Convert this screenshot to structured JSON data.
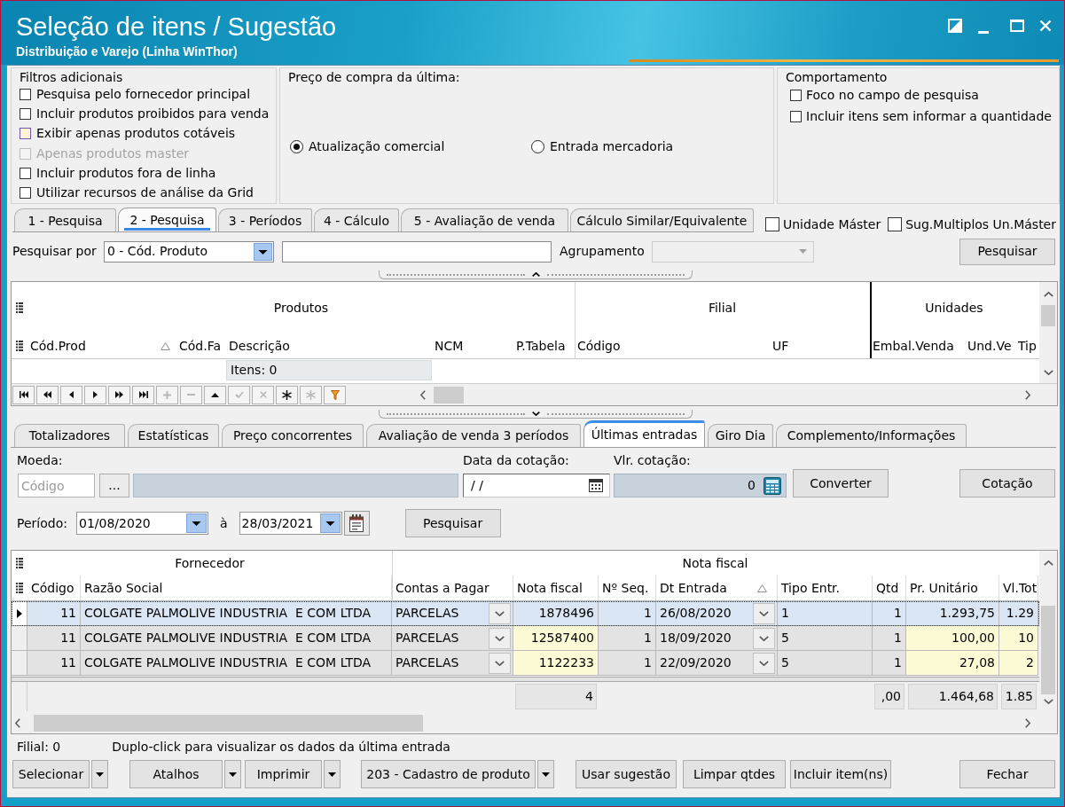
{
  "window": {
    "title": "Seleção de itens / Sugestão",
    "subtitle": "Distribuição e Varejo (Linha WinThor)"
  },
  "filters": {
    "additional": {
      "title": "Filtros adicionais",
      "options": [
        {
          "label": "Pesquisa pelo fornecedor principal",
          "checked": false,
          "disabled": false,
          "highlighted": false
        },
        {
          "label": "Incluir produtos proibidos para venda",
          "checked": false,
          "disabled": false,
          "highlighted": false
        },
        {
          "label": "Exibir apenas produtos cotáveis",
          "checked": false,
          "disabled": false,
          "highlighted": true
        },
        {
          "label": "Apenas produtos master",
          "checked": false,
          "disabled": true,
          "highlighted": false
        },
        {
          "label": "Incluir produtos fora de linha",
          "checked": false,
          "disabled": false,
          "highlighted": false
        },
        {
          "label": "Utilizar recursos de análise da Grid",
          "checked": false,
          "disabled": false,
          "highlighted": false
        }
      ]
    },
    "last_purchase_price": {
      "title": "Preço de compra da última:",
      "options": [
        {
          "label": "Atualização comercial",
          "selected": true
        },
        {
          "label": "Entrada mercadoria",
          "selected": false
        }
      ]
    },
    "behavior": {
      "title": "Comportamento",
      "options": [
        {
          "label": "Foco no campo de pesquisa",
          "checked": false
        },
        {
          "label": "Incluir itens sem informar a quantidade",
          "checked": false
        }
      ]
    }
  },
  "search_tabs": [
    {
      "label": "1 - Pesquisa",
      "selected": false
    },
    {
      "label": "2 - Pesquisa",
      "selected": true
    },
    {
      "label": "3 - Períodos",
      "selected": false
    },
    {
      "label": "4 - Cálculo",
      "selected": false
    },
    {
      "label": "5 - Avaliação de venda",
      "selected": false
    },
    {
      "label": "Cálculo Similar/Equivalente",
      "selected": false
    }
  ],
  "unit_options": [
    {
      "label": "Unidade Máster",
      "checked": false
    },
    {
      "label": "Sug.Multiplos Un.Máster",
      "checked": false
    }
  ],
  "search": {
    "label": "Pesquisar por",
    "search_by": "0 - Cód. Produto",
    "grouping": {
      "label": "Agrupamento",
      "disabled": true
    },
    "button": "Pesquisar"
  },
  "products_grid": {
    "column_groups": [
      {
        "label": "Produtos",
        "columns": [
          {
            "label": "Cód.Prod",
            "sorted": true
          },
          {
            "label": "Cód.Fa",
            "sorted": false
          },
          {
            "label": "Descrição",
            "sorted": false,
            "summary": "Itens: 0"
          },
          {
            "label": "NCM",
            "sorted": false
          },
          {
            "label": "P.Tabela",
            "sorted": false
          }
        ]
      },
      {
        "label": "Filial",
        "columns": [
          {
            "label": "Código",
            "sorted": false
          },
          {
            "label": "UF",
            "sorted": false
          }
        ]
      },
      {
        "label": "Unidades",
        "columns": [
          {
            "label": "Embal.Venda",
            "sorted": false
          },
          {
            "label": "Und.Ve",
            "sorted": false
          },
          {
            "label": "Tip",
            "sorted": false
          }
        ]
      }
    ]
  },
  "navigator": [
    {
      "kind": "first",
      "disabled": false
    },
    {
      "kind": "prior_page",
      "disabled": false
    },
    {
      "kind": "prior",
      "disabled": false
    },
    {
      "kind": "next",
      "disabled": false
    },
    {
      "kind": "next_page",
      "disabled": false
    },
    {
      "kind": "last",
      "disabled": false
    },
    {
      "kind": "insert",
      "disabled": true
    },
    {
      "kind": "delete",
      "disabled": true
    },
    {
      "kind": "edit",
      "disabled": false
    },
    {
      "kind": "post",
      "disabled": true
    },
    {
      "kind": "cancel",
      "disabled": true
    },
    {
      "kind": "bookmark",
      "disabled": false
    },
    {
      "kind": "goto_bookmark",
      "disabled": true
    },
    {
      "kind": "filter",
      "disabled": false
    }
  ],
  "detail_tabs": [
    {
      "label": "Totalizadores",
      "selected": false
    },
    {
      "label": "Estatísticas",
      "selected": false
    },
    {
      "label": "Preço concorrentes",
      "selected": false
    },
    {
      "label": "Avaliação de venda 3 períodos",
      "selected": false
    },
    {
      "label": "Últimas entradas",
      "selected": true
    },
    {
      "label": "Giro Dia",
      "selected": false
    },
    {
      "label": "Complemento/Informações",
      "selected": false
    }
  ],
  "currency": {
    "label": "Moeda:",
    "code": {
      "placeholder": "Código"
    },
    "browse_button": "...",
    "quote_date_label": "Data da cotação:",
    "quote_date": "/ /",
    "quote_value_label": "Vlr. cotação:",
    "quote_value": "0",
    "convert_button": "Converter",
    "quote_button": "Cotação"
  },
  "period": {
    "label": "Período:",
    "from": "01/08/2020",
    "separator": "à",
    "to": "28/03/2021",
    "button": "Pesquisar"
  },
  "entries_grid": {
    "column_groups": [
      {
        "label": "Fornecedor",
        "columns": [
          {
            "label": "Código",
            "kind": "number",
            "sorted": false,
            "highlighted": false
          },
          {
            "label": "Razão Social",
            "kind": "text",
            "sorted": false,
            "highlighted": false
          }
        ]
      },
      {
        "label": "Nota fiscal",
        "columns": [
          {
            "label": "Contas a Pagar",
            "kind": "combo",
            "sorted": false,
            "highlighted": false
          },
          {
            "label": "Nota fiscal",
            "kind": "number",
            "sorted": false,
            "highlighted": true,
            "total": "4"
          },
          {
            "label": "Nº Seq.",
            "kind": "number",
            "sorted": false,
            "highlighted": false
          },
          {
            "label": "Dt Entrada",
            "kind": "combo",
            "sorted": true,
            "highlighted": false
          },
          {
            "label": "Tipo Entr.",
            "kind": "text",
            "sorted": false,
            "highlighted": false
          },
          {
            "label": "Qtd",
            "kind": "number",
            "sorted": false,
            "highlighted": false,
            "total": ",00"
          },
          {
            "label": "Pr. Unitário",
            "kind": "number",
            "sorted": false,
            "highlighted": true,
            "total": "1.464,68"
          },
          {
            "label": "Vl.Tot",
            "kind": "number",
            "sorted": false,
            "highlighted": true,
            "total": "1.85"
          }
        ]
      }
    ],
    "rows": [
      {
        "selected": true,
        "cells": [
          "11",
          "COLGATE PALMOLIVE INDUSTRIA  E COM LTDA",
          "PARCELAS",
          "1878496",
          "1",
          "26/08/2020",
          "1",
          "1",
          "1.293,75",
          "1.29"
        ]
      },
      {
        "selected": false,
        "cells": [
          "11",
          "COLGATE PALMOLIVE INDUSTRIA  E COM LTDA",
          "PARCELAS",
          "12587400",
          "1",
          "18/09/2020",
          "5",
          "1",
          "100,00",
          "10"
        ]
      },
      {
        "selected": false,
        "cells": [
          "11",
          "COLGATE PALMOLIVE INDUSTRIA  E COM LTDA",
          "PARCELAS",
          "1122233",
          "1",
          "22/09/2020",
          "5",
          "1",
          "27,08",
          "2"
        ]
      }
    ]
  },
  "status": {
    "branch": "Filial: 0",
    "hint": "Duplo-click para visualizar os dados da última entrada"
  },
  "actions": [
    {
      "label": "Selecionar",
      "kind": "split"
    },
    {
      "label": "Atalhos",
      "kind": "split"
    },
    {
      "label": "Imprimir",
      "kind": "split"
    },
    {
      "label": "203 - Cadastro de produto",
      "kind": "split"
    },
    {
      "label": "Usar sugestão",
      "kind": "button"
    },
    {
      "label": "Limpar qtdes",
      "kind": "button"
    },
    {
      "label": "Incluir item(ns)",
      "kind": "button"
    },
    {
      "label": "Fechar",
      "kind": "button"
    }
  ]
}
